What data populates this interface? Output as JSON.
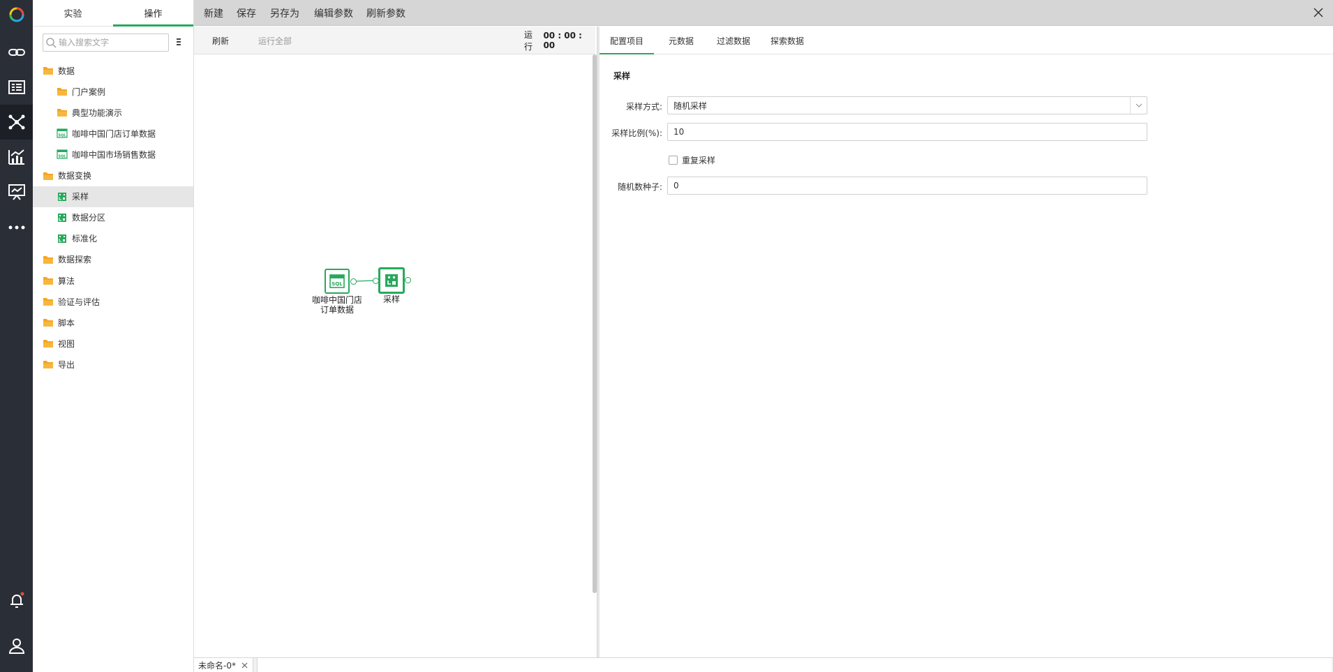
{
  "left_panel": {
    "tabs": [
      {
        "label": "实验"
      },
      {
        "label": "操作"
      }
    ],
    "search_placeholder": "输入搜索文字",
    "tree": [
      {
        "label": "数据",
        "kind": "folder-open"
      },
      {
        "label": "门户案例",
        "kind": "folder"
      },
      {
        "label": "典型功能演示",
        "kind": "folder"
      },
      {
        "label": "咖啡中国门店订单数据",
        "kind": "sql"
      },
      {
        "label": "咖啡中国市场销售数据",
        "kind": "sql"
      },
      {
        "label": "数据变换",
        "kind": "folder-open"
      },
      {
        "label": "采样",
        "kind": "op"
      },
      {
        "label": "数据分区",
        "kind": "op"
      },
      {
        "label": "标准化",
        "kind": "op"
      },
      {
        "label": "数据探索",
        "kind": "folder"
      },
      {
        "label": "算法",
        "kind": "folder"
      },
      {
        "label": "验证与评估",
        "kind": "folder"
      },
      {
        "label": "脚本",
        "kind": "folder"
      },
      {
        "label": "视图",
        "kind": "folder"
      },
      {
        "label": "导出",
        "kind": "folder"
      }
    ]
  },
  "toolbar": {
    "new": "新建",
    "save": "保存",
    "save_as": "另存为",
    "edit_params": "编辑参数",
    "refresh_params": "刷新参数"
  },
  "canvas_toolbar": {
    "refresh": "刷新",
    "run_all": "运行全部",
    "run_label": "运行",
    "run_time": "00 : 00 : 00"
  },
  "canvas": {
    "nodes": [
      {
        "label_line1": "咖啡中国门店",
        "label_line2": "订单数据"
      },
      {
        "label_line1": "采样"
      }
    ]
  },
  "right_panel": {
    "tabs": [
      {
        "label": "配置项目"
      },
      {
        "label": "元数据"
      },
      {
        "label": "过滤数据"
      },
      {
        "label": "探索数据"
      }
    ],
    "section_title": "采样",
    "fields": {
      "method_label": "采样方式:",
      "method_value": "随机采样",
      "ratio_label": "采样比例(%):",
      "ratio_value": "10",
      "repeat_label": "重复采样",
      "seed_label": "随机数种子:",
      "seed_value": "0"
    }
  },
  "bottom": {
    "doc_tab": "未命名-0*"
  },
  "colors": {
    "accent": "#27a95d",
    "rail": "#2a2e37",
    "folder": "#f5a623"
  }
}
